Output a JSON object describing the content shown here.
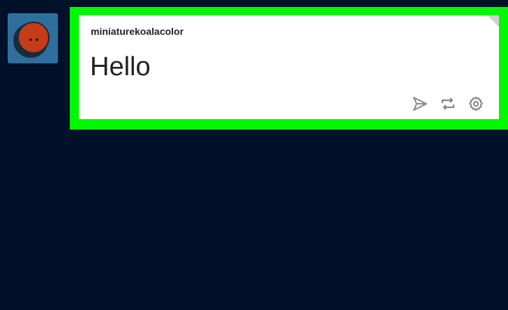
{
  "post": {
    "username": "miniaturekoalacolor",
    "text": "Hello"
  },
  "avatar": {
    "icon": "koala-face-icon"
  },
  "actions": [
    {
      "icon": "send-icon"
    },
    {
      "icon": "reblog-icon"
    },
    {
      "icon": "gear-icon"
    }
  ],
  "colors": {
    "page_background": "#001129",
    "highlight_border": "#00f800",
    "card_background": "#ffffff",
    "icon_gray": "#888888",
    "avatar_background": "#2f6f9e",
    "avatar_face": "#c63c1a"
  }
}
